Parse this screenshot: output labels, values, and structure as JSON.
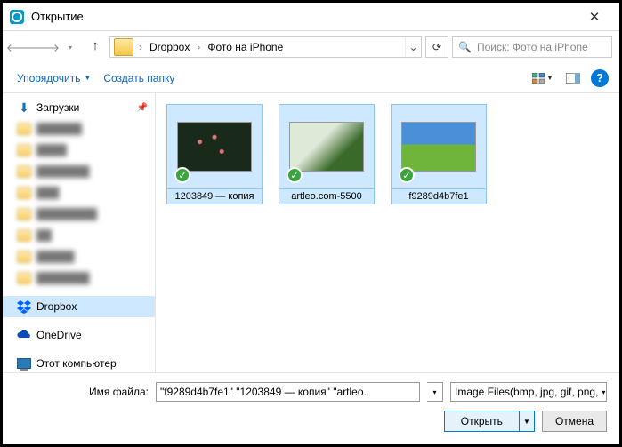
{
  "titlebar": {
    "title": "Открытие"
  },
  "breadcrumb": {
    "seg1": "Dropbox",
    "seg2": "Фото на iPhone"
  },
  "search": {
    "placeholder": "Поиск: Фото на iPhone"
  },
  "toolbar": {
    "organize": "Упорядочить",
    "newfolder": "Создать папку"
  },
  "sidebar": {
    "downloads": "Загрузки",
    "dropbox": "Dropbox",
    "onedrive": "OneDrive",
    "thispc": "Этот компьютер"
  },
  "thumbs": {
    "t1": "1203849 — копия",
    "t2": "artleo.com-5500",
    "t3": "f9289d4b7fe1"
  },
  "footer": {
    "filename_label": "Имя файла:",
    "filename_value": "\"f9289d4b7fe1\" \"1203849 — копия\" \"artleo.",
    "filter": "Image Files(bmp, jpg, gif, png,",
    "open": "Открыть",
    "cancel": "Отмена"
  }
}
